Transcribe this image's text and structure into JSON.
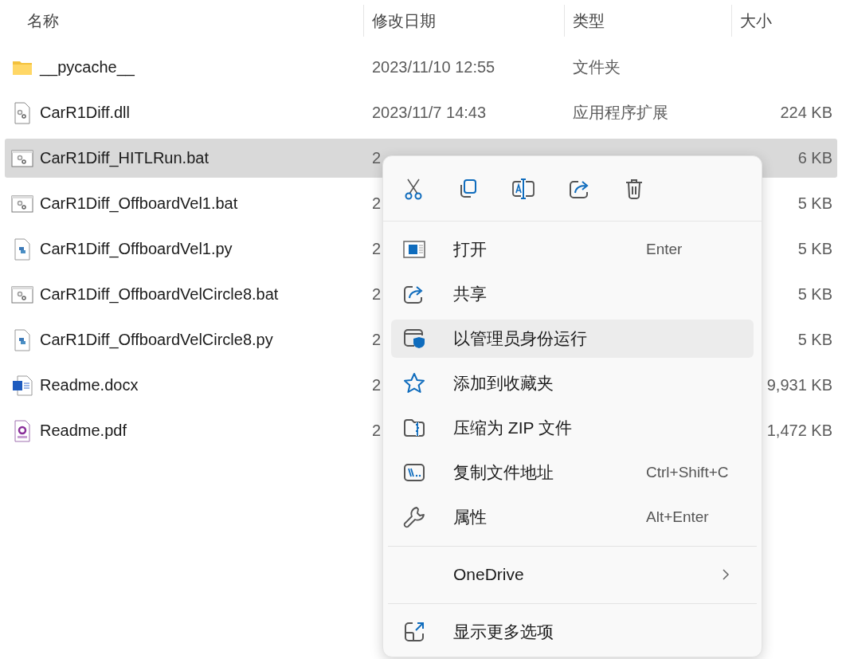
{
  "columns": [
    "名称",
    "修改日期",
    "类型",
    "大小"
  ],
  "files": [
    {
      "kind": "folder",
      "name": "__pycache__",
      "modified": "2023/11/10 12:55",
      "type": "文件夹",
      "selected": false
    },
    {
      "kind": "dll",
      "name": "CarR1Diff.dll",
      "modified": "2023/11/7 14:43",
      "type": "应用程序扩展",
      "size": "224 KB",
      "selected": false
    },
    {
      "kind": "bat",
      "name": "CarR1Diff_HITLRun.bat",
      "modified": "2",
      "size": "6 KB",
      "selected": true
    },
    {
      "kind": "bat",
      "name": "CarR1Diff_OffboardVel1.bat",
      "modified": "2",
      "size": "5 KB",
      "selected": false
    },
    {
      "kind": "py",
      "name": "CarR1Diff_OffboardVel1.py",
      "modified": "2",
      "size": "5 KB",
      "selected": false
    },
    {
      "kind": "bat",
      "name": "CarR1Diff_OffboardVelCircle8.bat",
      "modified": "2",
      "size": "5 KB",
      "selected": false
    },
    {
      "kind": "py",
      "name": "CarR1Diff_OffboardVelCircle8.py",
      "modified": "2",
      "size": "5 KB",
      "selected": false
    },
    {
      "kind": "docx",
      "name": "Readme.docx",
      "modified": "2",
      "size": "9,931 KB",
      "selected": false
    },
    {
      "kind": "pdf",
      "name": "Readme.pdf",
      "modified": "2",
      "size": "1,472 KB",
      "selected": false
    }
  ],
  "context_menu": {
    "toolbar": [
      {
        "kind": "cut"
      },
      {
        "kind": "copy"
      },
      {
        "kind": "rename"
      },
      {
        "kind": "share"
      },
      {
        "kind": "delete"
      }
    ],
    "items": [
      {
        "kind": "command",
        "label": "打开",
        "shortcut": "Enter",
        "selected": false
      },
      {
        "kind": "command",
        "label": "共享",
        "selected": false
      },
      {
        "kind": "command",
        "label": "以管理员身份运行",
        "selected": true
      },
      {
        "kind": "command",
        "label": "添加到收藏夹",
        "selected": false
      },
      {
        "kind": "command",
        "label": "压缩为 ZIP 文件",
        "selected": false
      },
      {
        "kind": "command",
        "label": "复制文件地址",
        "shortcut": "Ctrl+Shift+C",
        "selected": false
      },
      {
        "kind": "command",
        "label": "属性",
        "shortcut": "Alt+Enter",
        "selected": false
      },
      {
        "kind": "separator"
      },
      {
        "kind": "submenu",
        "label": "OneDrive",
        "selected": false
      },
      {
        "kind": "separator"
      },
      {
        "kind": "command",
        "label": "显示更多选项",
        "selected": false
      }
    ]
  }
}
